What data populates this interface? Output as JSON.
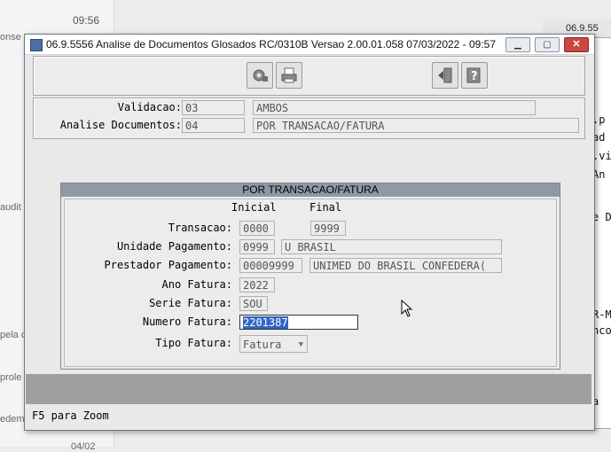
{
  "background": {
    "time": "09:56",
    "left_snippets": [
      "onse",
      "audit",
      "pela c",
      "prole",
      "edem",
      "04/02"
    ],
    "right_window_title": "06.9.55",
    "right_texts": [
      ".p",
      "ad",
      ".vi",
      "An",
      "e D",
      "R-M",
      "nco",
      "a"
    ]
  },
  "window": {
    "title": "06.9.5556   Analise  de Documentos Glosados RC/0310B Versao 2.00.01.058 07/03/2022 - 09:57",
    "minimize": "▁",
    "restore": "▢",
    "close": "✕"
  },
  "toolbar": {
    "icons": [
      "settings-icon",
      "print-icon",
      "exit-icon",
      "help-icon"
    ]
  },
  "header_fields": {
    "validacao_label": "Validacao:",
    "validacao_code": "03",
    "validacao_desc": "AMBOS",
    "analise_label": "Analise Documentos:",
    "analise_code": "04",
    "analise_desc": "POR TRANSACAO/FATURA"
  },
  "group": {
    "title": "POR TRANSACAO/FATURA",
    "col_inicial": "Inicial",
    "col_final": "Final",
    "transacao_label": "Transacao:",
    "transacao_inicial": "0000",
    "transacao_final": "9999",
    "unidade_label": "Unidade Pagamento:",
    "unidade_code": "0999",
    "unidade_name": "U BRASIL",
    "prestador_label": "Prestador Pagamento:",
    "prestador_code": "00009999",
    "prestador_name": "UNIMED DO BRASIL CONFEDERA(",
    "ano_label": "Ano Fatura:",
    "ano_value": "2022",
    "serie_label": "Serie Fatura:",
    "serie_value": "SOU",
    "numero_label": "Numero Fatura:",
    "numero_value": "2201387",
    "tipo_label": "Tipo Fatura:",
    "tipo_value": "Fatura"
  },
  "status_bar": {
    "text": "F5 para Zoom"
  }
}
